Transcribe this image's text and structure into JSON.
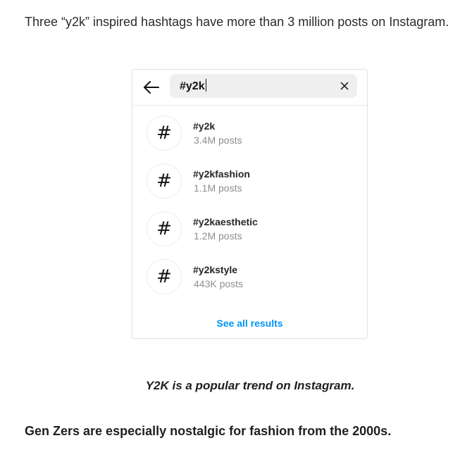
{
  "article": {
    "intro": "Three “y2k” inspired hashtags have more than 3 million posts on Instagram.",
    "caption": "Y2K is a popular trend on Instagram.",
    "closing": "Gen Zers are especially nostalgic for fashion from the 2000s."
  },
  "search": {
    "query": "#y2k",
    "back_icon": "arrow-left-icon",
    "clear_icon": "close-icon"
  },
  "results": [
    {
      "symbol": "#",
      "tag": "#y2k",
      "posts": "3.4M posts"
    },
    {
      "symbol": "#",
      "tag": "#y2kfashion",
      "posts": "1.1M posts"
    },
    {
      "symbol": "#",
      "tag": "#y2kaesthetic",
      "posts": "1.2M posts"
    },
    {
      "symbol": "#",
      "tag": "#y2kstyle",
      "posts": "443K posts"
    }
  ],
  "see_all_label": "See all results",
  "colors": {
    "link": "#0095f6",
    "muted": "#8e8e8e",
    "search_bg": "#efefef"
  }
}
